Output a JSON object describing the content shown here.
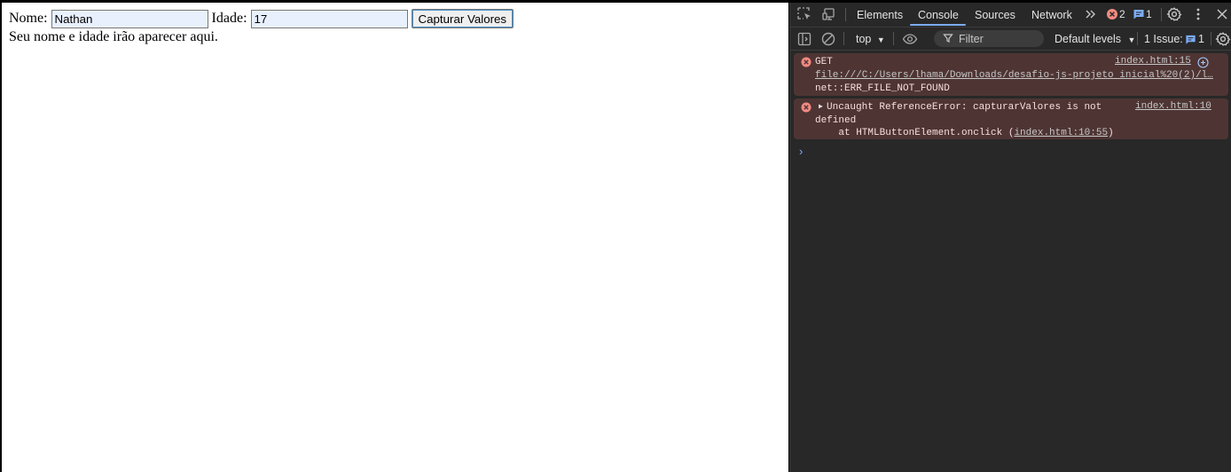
{
  "page": {
    "name_label": "Nome:",
    "name_value": "Nathan",
    "age_label": "Idade:",
    "age_value": "17",
    "capture_button": "Capturar Valores",
    "result_text": "Seu nome e idade irão aparecer aqui."
  },
  "devtools": {
    "tabs": [
      "Elements",
      "Console",
      "Sources",
      "Network"
    ],
    "active_tab": "Console",
    "error_count": "2",
    "message_count": "1",
    "context": "top",
    "filter_placeholder": "Filter",
    "levels": "Default levels",
    "issues_label": "1 Issue:",
    "issues_count": "1",
    "messages": [
      {
        "line1": "GET",
        "line2": "file:///C:/Users/lhama/Downloads/desafio-js-projeto inicial%20(2)/l…",
        "line3": "net::ERR_FILE_NOT_FOUND",
        "source": "index.html:15"
      },
      {
        "line1": "Uncaught ReferenceError: capturarValores is not",
        "line2": "defined",
        "line3_prefix": "    at HTMLButtonElement.onclick (",
        "line3_link": "index.html:10:55",
        "line3_suffix": ")",
        "source": "index.html:10"
      }
    ]
  },
  "colors": {
    "accent": "#7cacf8",
    "error_bg": "#4e3534",
    "error_icon": "#f28b82",
    "devtools_bg": "#282828"
  },
  "icons": [
    "inspect-icon",
    "device-toggle-icon",
    "more-tabs-icon",
    "error-icon",
    "message-icon",
    "settings-icon",
    "kebab-icon",
    "close-icon",
    "sidebar-icon",
    "clear-icon",
    "eye-icon",
    "filter-icon",
    "issue-icon",
    "gear-icon"
  ]
}
